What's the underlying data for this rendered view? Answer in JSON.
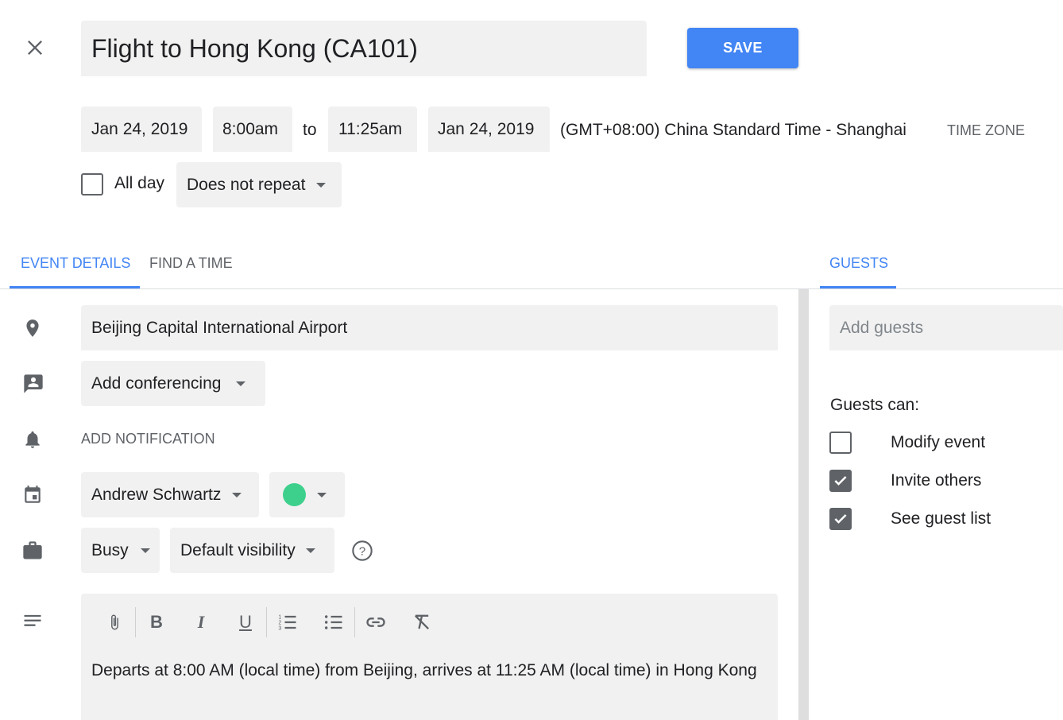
{
  "header": {
    "title": "Flight to Hong Kong (CA101)",
    "save_label": "SAVE",
    "close_icon": "close-icon"
  },
  "datetime": {
    "start_date": "Jan 24, 2019",
    "start_time": "8:00am",
    "to_label": "to",
    "end_time": "11:25am",
    "end_date": "Jan 24, 2019",
    "timezone": "(GMT+08:00) China Standard Time - Shanghai",
    "timezone_button": "TIME ZONE"
  },
  "options": {
    "all_day_label": "All day",
    "all_day_checked": false,
    "repeat_value": "Does not repeat"
  },
  "tabs": {
    "event_details": "EVENT DETAILS",
    "find_a_time": "FIND A TIME",
    "guests": "GUESTS",
    "active": "EVENT DETAILS"
  },
  "details": {
    "location": "Beijing Capital International Airport",
    "conferencing": "Add conferencing",
    "add_notification": "ADD NOTIFICATION",
    "calendar_owner": "Andrew Schwartz",
    "calendar_color": "#3dd08c",
    "availability": "Busy",
    "visibility": "Default visibility",
    "description": "Departs at 8:00 AM (local time) from Beijing, arrives at 11:25 AM (local time) in Hong Kong"
  },
  "guests": {
    "input_placeholder": "Add guests",
    "guests_can_label": "Guests can:",
    "permissions": [
      {
        "label": "Modify event",
        "checked": false
      },
      {
        "label": "Invite others",
        "checked": true
      },
      {
        "label": "See guest list",
        "checked": true
      }
    ]
  },
  "colors": {
    "accent": "#4285f4",
    "save_button": "#4285f4",
    "icon_gray": "#5f6368"
  }
}
